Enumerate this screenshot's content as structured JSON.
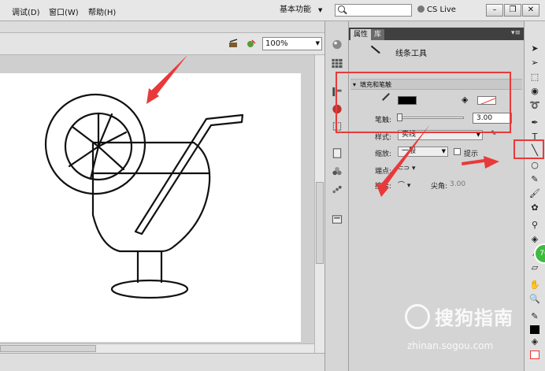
{
  "menu": {
    "debug": "调试(D)",
    "window": "窗口(W)",
    "help": "帮助(H)"
  },
  "workspace": {
    "label": "基本功能"
  },
  "search": {
    "placeholder": ""
  },
  "cslive": "CS Live",
  "zoom": "100%",
  "panel": {
    "tab_properties": "属性",
    "tab_library": "库",
    "tool_name": "线条工具",
    "section_fill_stroke": "填充和笔触",
    "stroke_label": "笔触:",
    "stroke_value": "3.00",
    "style_label": "样式:",
    "style_value": "实线",
    "scale_label": "缩放:",
    "scale_value": "一般",
    "hint_label": "提示",
    "cap_label": "端点:",
    "join_label": "接合:",
    "miter_label": "尖角:",
    "miter_value": "3.00"
  },
  "watermark": {
    "text": "搜狗指南",
    "url": "zhinan.sogou.com"
  },
  "colors": {
    "stroke": "#000000",
    "accent_red": "#e83a3a"
  }
}
